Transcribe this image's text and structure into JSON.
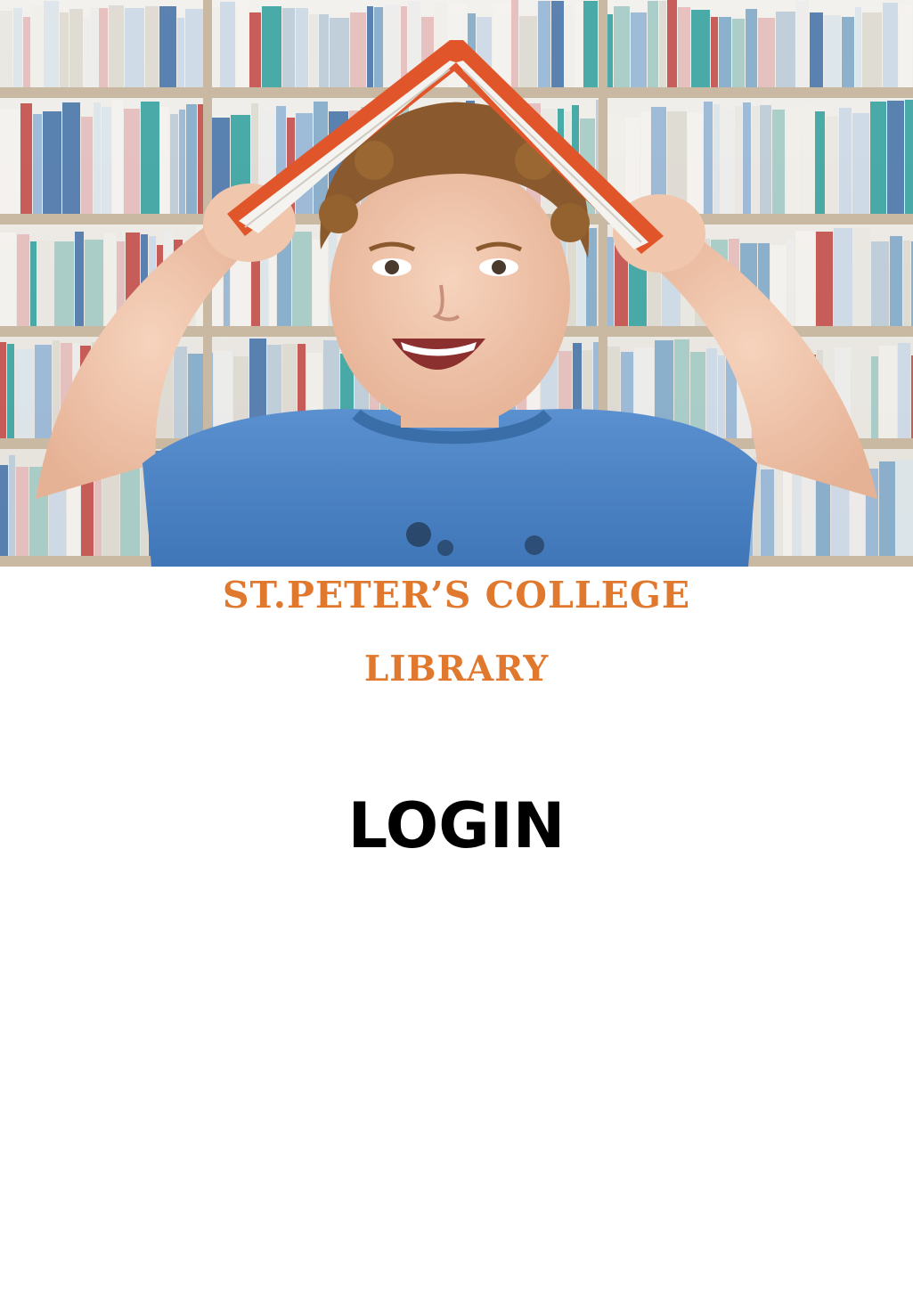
{
  "hero": {
    "image": "child-with-book-on-head-in-library-photo"
  },
  "header": {
    "title_line1": "ST.PETER’S COLLEGE",
    "title_line2": "LIBRARY"
  },
  "login": {
    "label": "LOGIN"
  },
  "colors": {
    "accent": "#e0782e",
    "text": "#000000",
    "background": "#ffffff",
    "shirt": "#4f86c6",
    "book_cover": "#e0562a"
  }
}
